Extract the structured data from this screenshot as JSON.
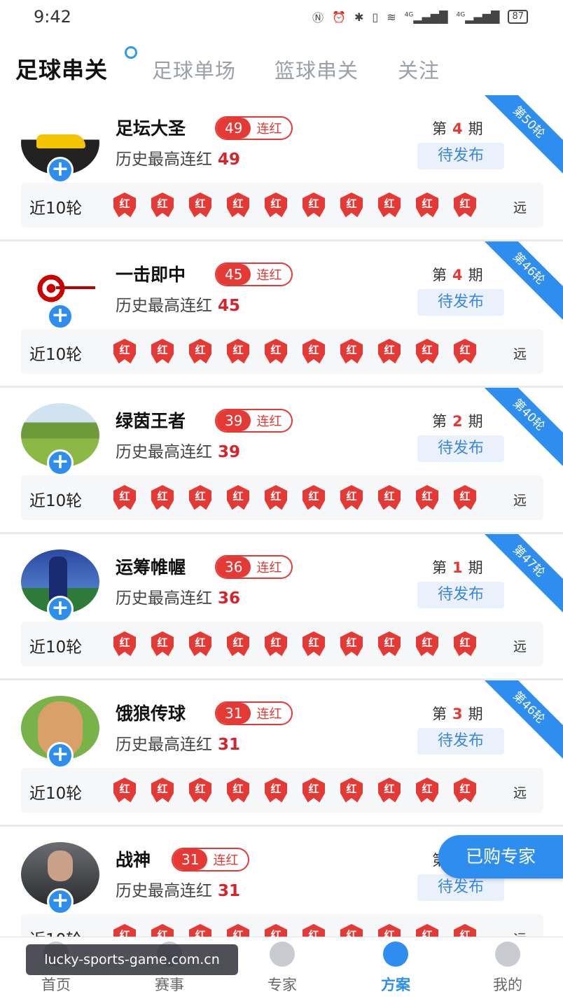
{
  "status": {
    "time": "9:42",
    "battery": "87",
    "signal": "4G",
    "network2": "4G"
  },
  "tabs": [
    "足球串关",
    "足球单场",
    "篮球串关",
    "关注"
  ],
  "active_tab": 0,
  "experts": [
    {
      "name": "足坛大圣",
      "streak": "49",
      "streak_label": "连红",
      "history_label": "历史最高连红",
      "history_value": "49",
      "period_prefix": "第",
      "period_num": "4",
      "period_suffix": "期",
      "status": "待发布",
      "ribbon": "第50轮",
      "recent_label": "近10轮",
      "badge_text": "红",
      "far_label": "远",
      "avatar": "car"
    },
    {
      "name": "一击即中",
      "streak": "45",
      "streak_label": "连红",
      "history_label": "历史最高连红",
      "history_value": "45",
      "period_prefix": "第",
      "period_num": "4",
      "period_suffix": "期",
      "status": "待发布",
      "ribbon": "第46轮",
      "recent_label": "近10轮",
      "badge_text": "红",
      "far_label": "远",
      "avatar": "target"
    },
    {
      "name": "绿茵王者",
      "streak": "39",
      "streak_label": "连红",
      "history_label": "历史最高连红",
      "history_value": "39",
      "period_prefix": "第",
      "period_num": "2",
      "period_suffix": "期",
      "status": "待发布",
      "ribbon": "第40轮",
      "recent_label": "近10轮",
      "badge_text": "红",
      "far_label": "远",
      "avatar": "grass"
    },
    {
      "name": "运筹帷幄",
      "streak": "36",
      "streak_label": "连红",
      "history_label": "历史最高连红",
      "history_value": "36",
      "period_prefix": "第",
      "period_num": "1",
      "period_suffix": "期",
      "status": "待发布",
      "ribbon": "第47轮",
      "recent_label": "近10轮",
      "badge_text": "红",
      "far_label": "远",
      "avatar": "player"
    },
    {
      "name": "饿狼传球",
      "streak": "31",
      "streak_label": "连红",
      "history_label": "历史最高连红",
      "history_value": "31",
      "period_prefix": "第",
      "period_num": "3",
      "period_suffix": "期",
      "status": "待发布",
      "ribbon": "第46轮",
      "recent_label": "近10轮",
      "badge_text": "红",
      "far_label": "远",
      "avatar": "cartoon"
    },
    {
      "name": "战神",
      "streak": "31",
      "streak_label": "连红",
      "history_label": "历史最高连红",
      "history_value": "31",
      "period_prefix": "第",
      "period_num": "",
      "period_suffix": "",
      "status": "待发布",
      "ribbon": "",
      "recent_label": "近10轮",
      "badge_text": "红",
      "far_label": "远",
      "avatar": "man"
    }
  ],
  "colors": {
    "accent": "#2e8ef0",
    "red": "#e53935"
  },
  "float_button": "已购专家",
  "nav": [
    {
      "label": "首页",
      "icon": "home-icon"
    },
    {
      "label": "赛事",
      "icon": "match-icon"
    },
    {
      "label": "专家",
      "icon": "expert-icon"
    },
    {
      "label": "方案",
      "icon": "plan-icon"
    },
    {
      "label": "我的",
      "icon": "profile-icon"
    }
  ],
  "active_nav": 3,
  "watermark": "lucky-sports-game.com.cn"
}
